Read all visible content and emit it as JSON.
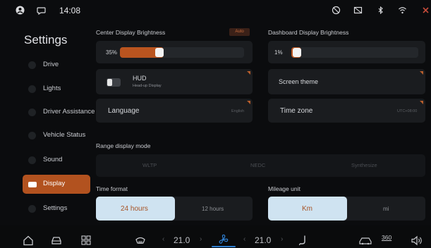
{
  "status_bar": {
    "time": "14:08",
    "left_icons": [
      "user-icon",
      "message-icon"
    ],
    "right_icons": [
      "no-camera-icon",
      "screen-off-icon",
      "bluetooth-icon",
      "wifi-icon",
      "close-icon"
    ]
  },
  "sidebar": {
    "title": "Settings",
    "items": [
      {
        "label": "Drive",
        "icon": "steering-wheel-icon",
        "active": false
      },
      {
        "label": "Lights",
        "icon": "light-bulb-icon",
        "active": false
      },
      {
        "label": "Driver Assistance",
        "icon": "driver-assist-icon",
        "active": false
      },
      {
        "label": "Vehicle Status",
        "icon": "vehicle-icon",
        "active": false
      },
      {
        "label": "Sound",
        "icon": "speaker-icon",
        "active": false
      },
      {
        "label": "Display",
        "icon": "display-icon",
        "active": true
      },
      {
        "label": "Settings",
        "icon": "gear-icon",
        "active": false
      }
    ]
  },
  "center_display": {
    "label": "Center Display Brightness",
    "auto_badge": "Auto",
    "value_text": "35%",
    "value": 0.35
  },
  "dashboard_display": {
    "label": "Dashboard Display Brightness",
    "value_text": "1%",
    "value": 0.01
  },
  "hud": {
    "title": "HUD",
    "subtitle": "Head-up Display",
    "enabled": false
  },
  "screen_theme": {
    "label": "Screen theme"
  },
  "language": {
    "label": "Language",
    "value": "English"
  },
  "time_zone": {
    "label": "Time zone",
    "value": "UTC+08:00"
  },
  "range_display": {
    "label": "Range display mode",
    "options": [
      "WLTP",
      "NEDC",
      "Synthesize"
    ]
  },
  "time_format": {
    "label": "Time format",
    "options": [
      "24 hours",
      "12 hours"
    ],
    "selected": "24 hours"
  },
  "mileage_unit": {
    "label": "Mileage unit",
    "options": [
      "Km",
      "mi"
    ],
    "selected": "Km"
  },
  "bottom_bar": {
    "left_icons": [
      "home-icon",
      "car-icon",
      "apps-grid-icon"
    ],
    "driver_temp": "21.0",
    "passenger_temp": "21.0",
    "climate_icons": [
      "defrost-icon",
      "fan-icon",
      "seat-icon"
    ],
    "right_icons": [
      "car-view-icon",
      "camera-360-icon",
      "volume-icon"
    ],
    "camera_label": "360"
  },
  "colors": {
    "accent": "#b9541f",
    "accent_text": "#a75325",
    "selected_segment": "#cfe3f1",
    "panel": "#1a1c1f",
    "background": "#0b0c0e",
    "fan_active": "#2f7fd0"
  }
}
